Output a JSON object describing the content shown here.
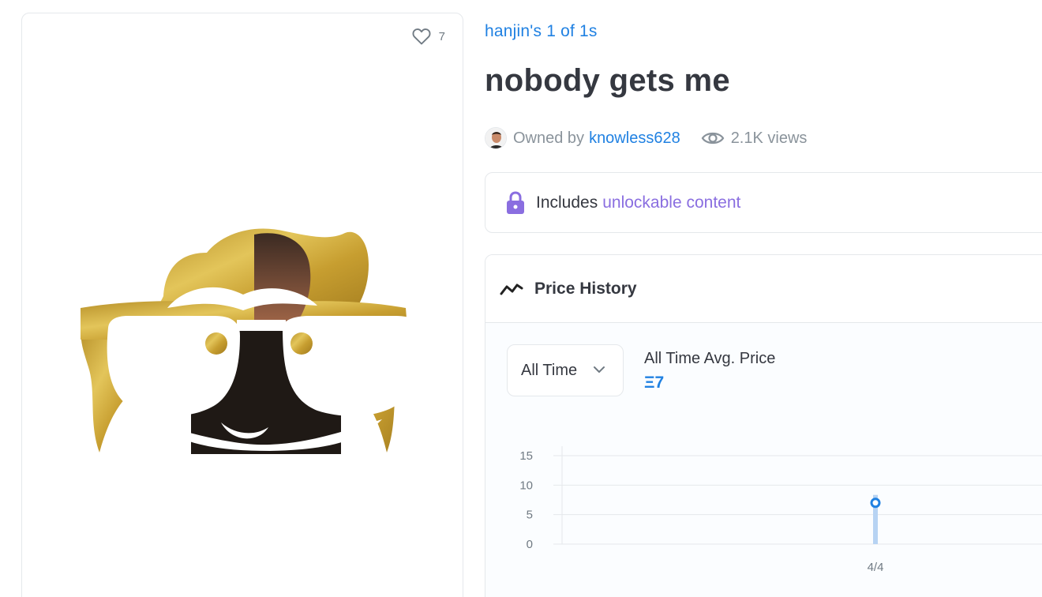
{
  "item": {
    "favorites_count": "7",
    "collection_name": "hanjin's 1 of 1s",
    "title": "nobody gets me",
    "owned_by_label": "Owned by",
    "owner": "knowless628",
    "views": "2.1K views"
  },
  "unlockable": {
    "prefix": "Includes",
    "link_text": "unlockable content"
  },
  "price_history": {
    "title": "Price History",
    "range_selected": "All Time",
    "avg_label": "All Time Avg. Price",
    "avg_value": "Ξ7"
  },
  "icons": {
    "favorite": "heart-outline-icon",
    "views": "eye-icon",
    "unlockable": "lock-icon",
    "price_history": "trend-line-icon",
    "range_dropdown": "chevron-down-icon"
  },
  "colors": {
    "link_blue": "#2081e2",
    "unlock_purple": "#8a6ee0",
    "text_dark": "#353840",
    "text_muted": "#8a939b",
    "artwork_gold": "#c9a532"
  },
  "chart_data": {
    "type": "scatter",
    "title": "",
    "xlabel": "",
    "ylabel": "",
    "y_ticks": [
      0,
      5,
      10,
      15
    ],
    "ylim": [
      0,
      15
    ],
    "x_ticks": [
      "4/4"
    ],
    "points": [
      {
        "x": "4/4",
        "y": 7
      }
    ],
    "grid": true
  }
}
